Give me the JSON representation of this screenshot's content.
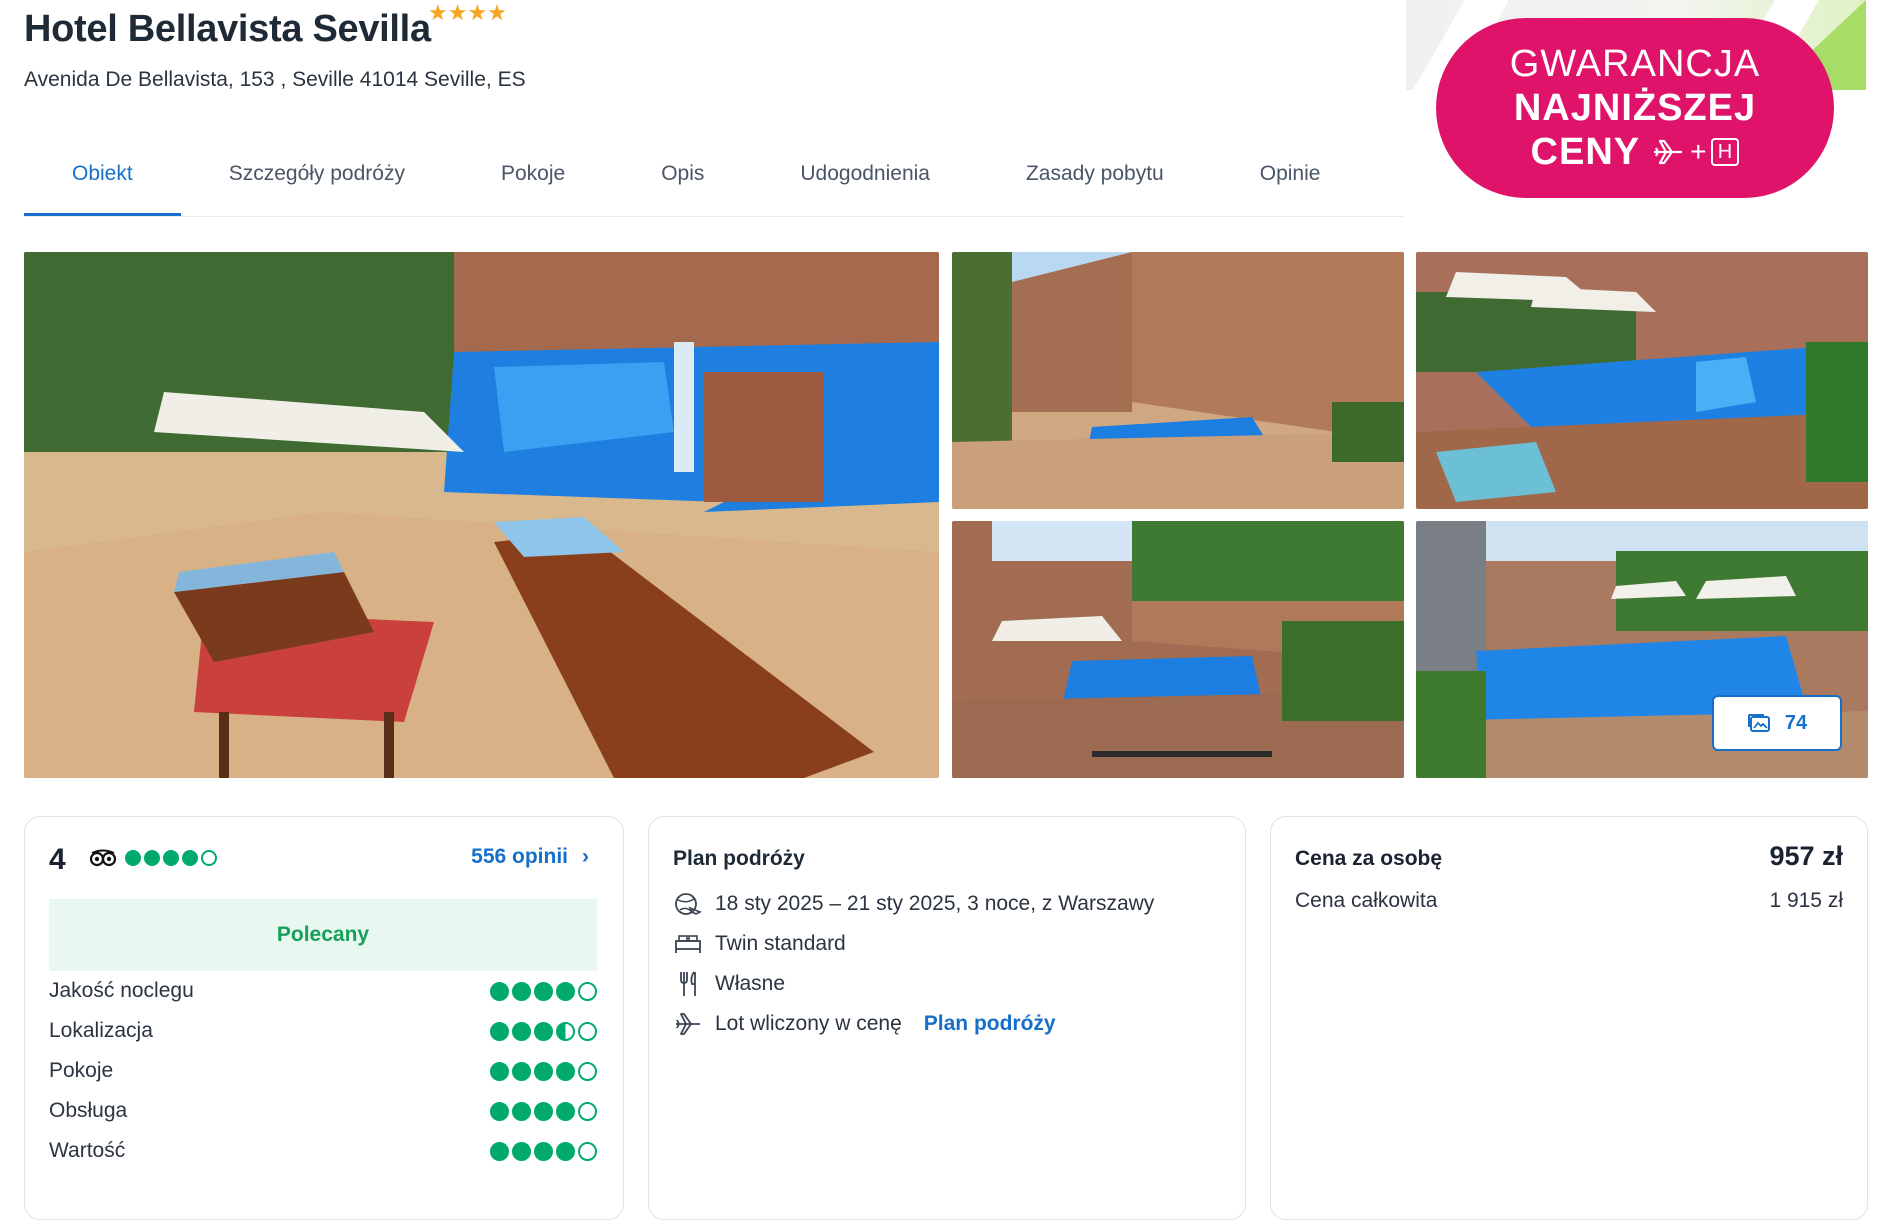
{
  "hotel": {
    "name": "Hotel Bellavista Sevilla",
    "stars": "★★★★",
    "address": "Avenida De Bellavista, 153 , Seville 41014 Seville, ES"
  },
  "tabs": [
    {
      "label": "Obiekt"
    },
    {
      "label": "Szczegóły podróży"
    },
    {
      "label": "Pokoje"
    },
    {
      "label": "Opis"
    },
    {
      "label": "Udogodnienia"
    },
    {
      "label": "Zasady pobytu"
    },
    {
      "label": "Opinie"
    }
  ],
  "badge": {
    "line1": "GWARANCJA",
    "line2": "NAJNIŻSZEJ",
    "line3": "CENY",
    "plus": "+",
    "h": "H",
    "color": "#e0136a"
  },
  "gallery": {
    "photo_count": "74"
  },
  "reviews": {
    "score": "4",
    "score_dots": 4,
    "opinions_link": "556 opinii",
    "recommended": "Polecany",
    "categories": [
      {
        "label": "Jakość noclegu",
        "rating": 4
      },
      {
        "label": "Lokalizacja",
        "rating": 3.5
      },
      {
        "label": "Pokoje",
        "rating": 4
      },
      {
        "label": "Obsługa",
        "rating": 4
      },
      {
        "label": "Wartość",
        "rating": 4
      }
    ]
  },
  "plan": {
    "title": "Plan podróży",
    "dates": "18 sty 2025 – 21 sty 2025, 3 noce, z Warszawy",
    "room": "Twin standard",
    "board": "Własne",
    "flight": "Lot wliczony w cenę",
    "flight_link": "Plan podróży"
  },
  "price": {
    "per_person_label": "Cena za osobę",
    "per_person_value": "957 zł",
    "total_label": "Cena całkowita",
    "total_value": "1 915 zł"
  },
  "colors": {
    "accent": "#1670c9",
    "tripadvisor": "#00aa6c",
    "recommended_bg": "#e8f7ef"
  }
}
